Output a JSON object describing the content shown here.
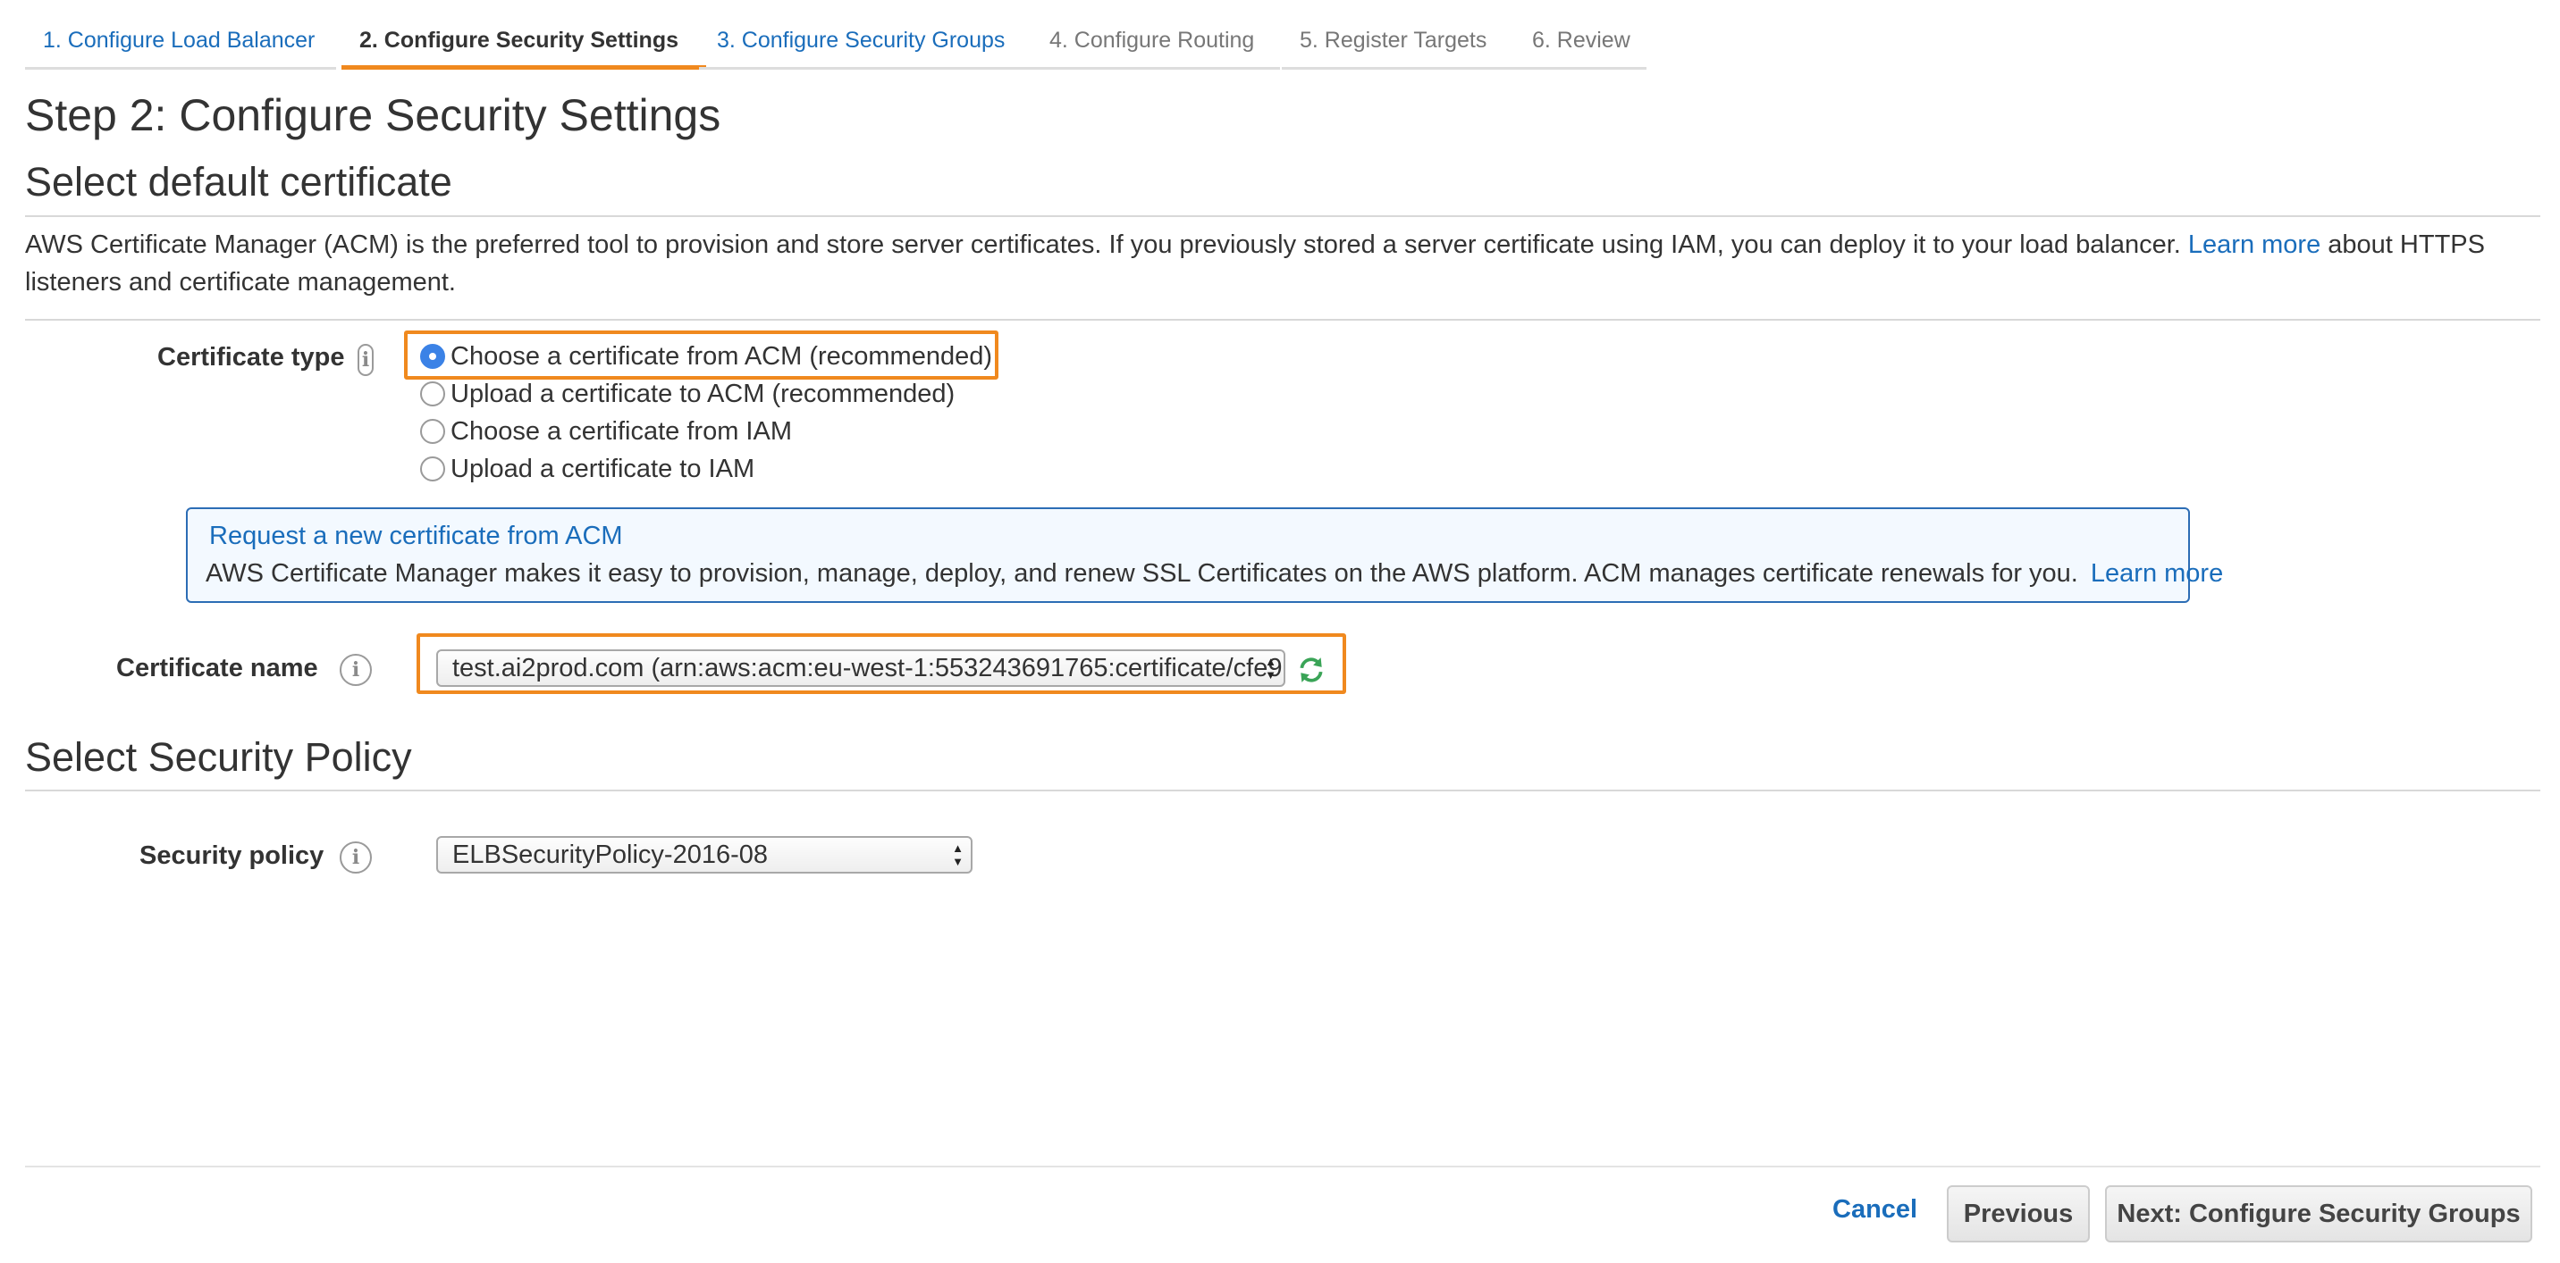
{
  "tabs": [
    {
      "label": "1. Configure Load Balancer",
      "state": "link"
    },
    {
      "label": "2. Configure Security Settings",
      "state": "active"
    },
    {
      "label": "3. Configure Security Groups",
      "state": "link"
    },
    {
      "label": "4. Configure Routing",
      "state": "disabled"
    },
    {
      "label": "5. Register Targets",
      "state": "disabled"
    },
    {
      "label": "6. Review",
      "state": "disabled"
    }
  ],
  "page": {
    "title": "Step 2: Configure Security Settings"
  },
  "certificate_section": {
    "heading": "Select default certificate",
    "description_before": "AWS Certificate Manager (ACM) is the preferred tool to provision and store server certificates. If you previously stored a server certificate using IAM, you can deploy it to your load balancer.",
    "learn_more": "Learn more",
    "description_after": "about HTTPS listeners and certificate management.",
    "type_label": "Certificate type",
    "type_options": [
      {
        "label": "Choose a certificate from ACM (recommended)",
        "selected": true
      },
      {
        "label": "Upload a certificate to ACM (recommended)",
        "selected": false
      },
      {
        "label": "Choose a certificate from IAM",
        "selected": false
      },
      {
        "label": "Upload a certificate to IAM",
        "selected": false
      }
    ],
    "info_box": {
      "link": "Request a new certificate from ACM",
      "text": "AWS Certificate Manager makes it easy to provision, manage, deploy, and renew SSL Certificates on the AWS platform. ACM manages certificate renewals for you.",
      "learn_more": "Learn more"
    },
    "name_label": "Certificate name",
    "name_value": "test.ai2prod.com (arn:aws:acm:eu-west-1:553243691765:certificate/cfe9"
  },
  "policy_section": {
    "heading": "Select Security Policy",
    "label": "Security policy",
    "value": "ELBSecurityPolicy-2016-08"
  },
  "footer": {
    "cancel": "Cancel",
    "previous": "Previous",
    "next": "Next: Configure Security Groups"
  },
  "colors": {
    "link": "#1a6dbb",
    "highlight": "#f0891e",
    "radio_selected": "#3b82e6",
    "info_border": "#2c6db5",
    "refresh": "#3aa457"
  },
  "icons": {
    "info": "info-icon",
    "refresh": "refresh-icon",
    "select_arrows": "select-arrows-icon"
  }
}
